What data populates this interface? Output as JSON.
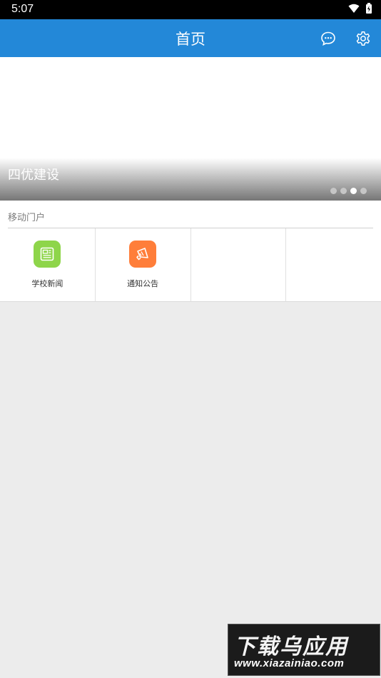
{
  "status_bar": {
    "time": "5:07"
  },
  "header": {
    "title": "首页",
    "message_icon": "chat-bubble-icon",
    "settings_icon": "gear-icon"
  },
  "banner": {
    "caption": "四优建设",
    "dots_total": 4,
    "active_dot": 3
  },
  "portal": {
    "section_title": "移动门户",
    "items": [
      {
        "label": "学校新闻",
        "icon": "newspaper-icon",
        "color": "#8ed54a"
      },
      {
        "label": "通知公告",
        "icon": "megaphone-icon",
        "color": "#ff7e3a"
      },
      {
        "label": "",
        "icon": ""
      },
      {
        "label": "",
        "icon": ""
      }
    ]
  },
  "watermark": {
    "main": "下载乌应用",
    "url": "www.xiazainiao.com"
  },
  "colors": {
    "app_bar": "#2388d8",
    "background": "#ececec"
  }
}
